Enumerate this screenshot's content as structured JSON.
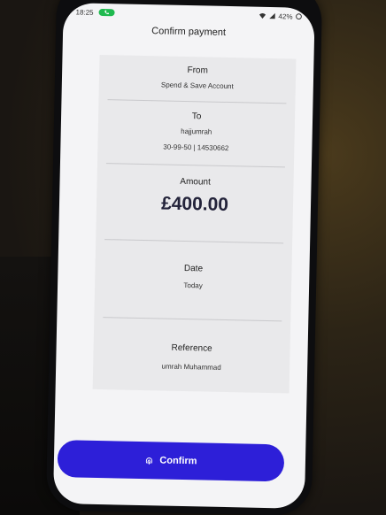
{
  "status_bar": {
    "time": "18:25",
    "battery": "42%"
  },
  "header": {
    "title": "Confirm payment"
  },
  "from": {
    "label": "From",
    "account": "Spend & Save Account"
  },
  "to": {
    "label": "To",
    "name": "hajjumrah",
    "details": "30-99-50 | 14530662"
  },
  "amount": {
    "label": "Amount",
    "value": "£400.00"
  },
  "date": {
    "label": "Date",
    "value": "Today"
  },
  "reference": {
    "label": "Reference",
    "value": "umrah Muhammad"
  },
  "actions": {
    "confirm_label": "Confirm"
  },
  "colors": {
    "confirm_button": "#2d1fd8",
    "call_pill": "#1fb94f",
    "card_background": "#e9e9eb",
    "amount_text": "#23233a"
  },
  "icons": {
    "call": "phone-icon",
    "wifi": "wifi-icon",
    "signal": "signal-icon",
    "battery": "battery-icon",
    "confirm": "fingerprint-icon"
  }
}
